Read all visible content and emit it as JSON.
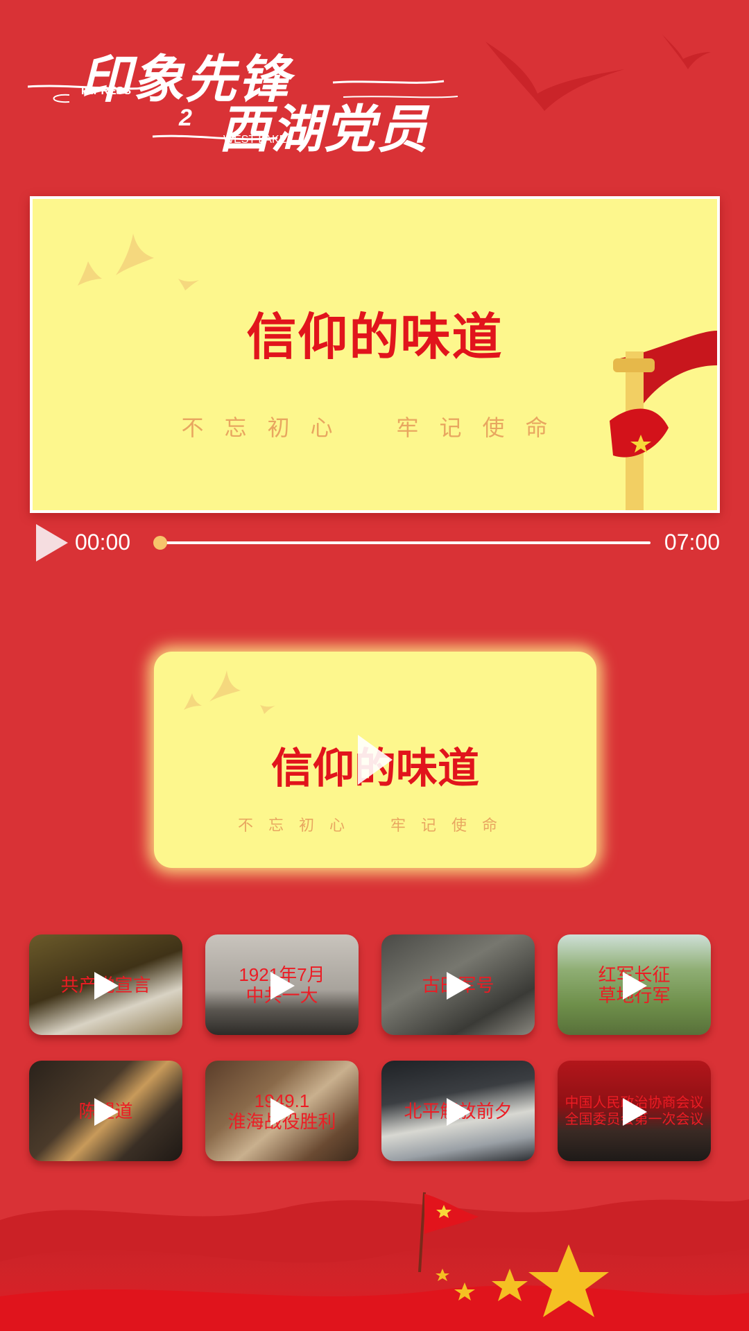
{
  "logo": {
    "line1": "印象先锋",
    "line1_en": "IMPRESS",
    "line2_num": "2",
    "line2": "西湖党员",
    "line2_en": "WEST LAKE"
  },
  "player": {
    "title": "信仰的味道",
    "subtitle": "不忘初心　牢记使命",
    "current_time": "00:00",
    "total_time": "07:00",
    "progress": 0
  },
  "featured": {
    "title": "信仰的味道",
    "subtitle": "不忘初心　牢记使命"
  },
  "thumbnails": [
    {
      "lines": [
        "共产党宣言"
      ],
      "icon": "play-icon"
    },
    {
      "lines": [
        "1921年7月",
        "中共一大"
      ],
      "icon": "play-icon"
    },
    {
      "lines": [
        "古田军号"
      ],
      "icon": "play-icon"
    },
    {
      "lines": [
        "红军长征",
        "草地行军"
      ],
      "icon": "play-icon"
    },
    {
      "lines": [
        "陈望道"
      ],
      "icon": "play-icon"
    },
    {
      "lines": [
        "1949.1",
        "淮海战役胜利"
      ],
      "icon": "play-icon"
    },
    {
      "lines": [
        "北平解放前夕"
      ],
      "icon": "play-icon"
    },
    {
      "lines": [
        "中国人民政治协商会议",
        "全国委员会第一次会议"
      ],
      "icon": "play-icon"
    }
  ],
  "colors": {
    "background": "#d93236",
    "card": "#fdf78d",
    "title_red": "#e1141c",
    "subtitle_orange": "#e8a660",
    "knob": "#f7c46b"
  }
}
